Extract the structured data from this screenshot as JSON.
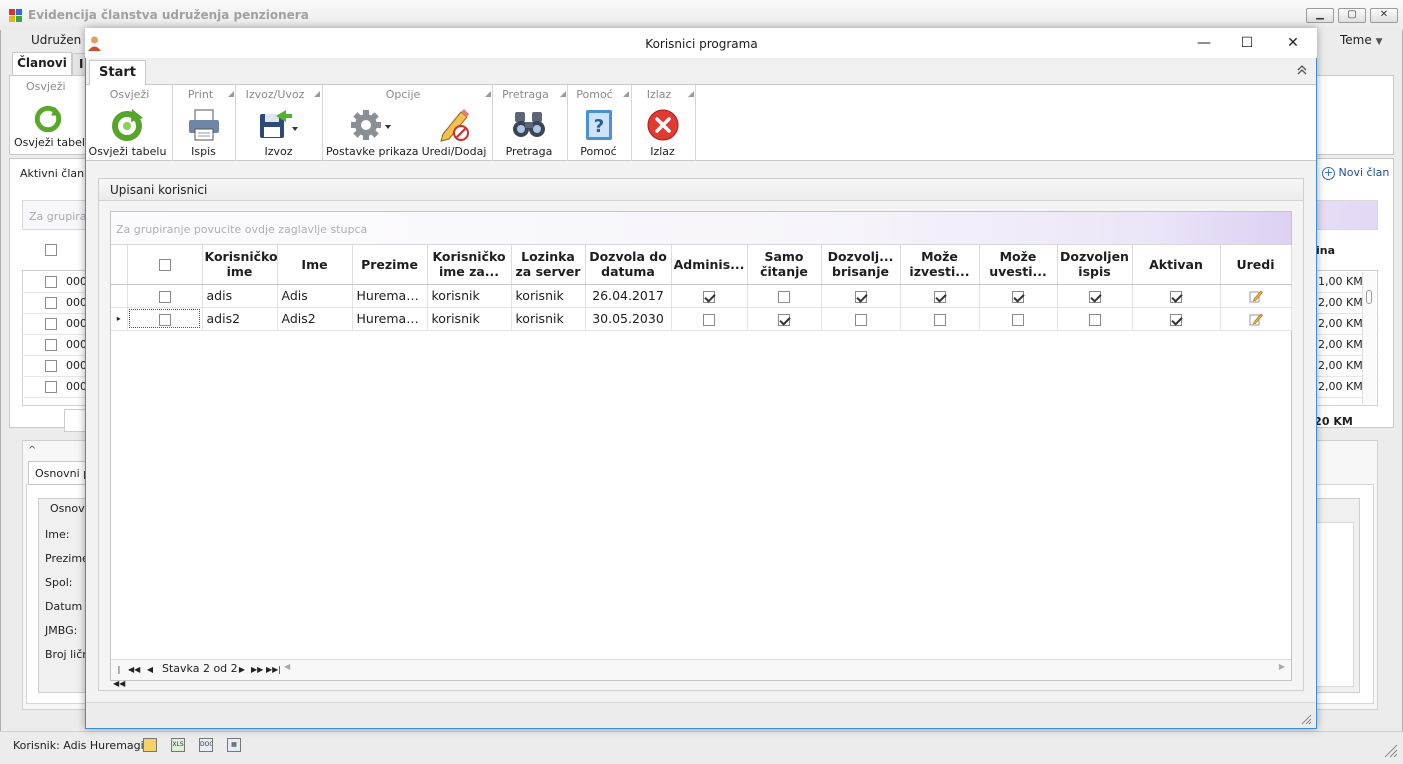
{
  "background": {
    "title": "Evidencija članstva udruženja penzionera",
    "menu_left": "Udružen",
    "menu_right": "Teme",
    "tab_clanovi": "Članovi",
    "tab_second": "I",
    "ribbon_group": "Osvježi",
    "refresh_label": "Osvježi tabelu",
    "aktivni": "Aktivni član",
    "novi_clan": "Novi član",
    "group_hint": "Za grupiranje",
    "col_ina": "ina",
    "rows": [
      {
        "code": "000",
        "km": "1,00 KM"
      },
      {
        "code": "000",
        "km": "2,00 KM"
      },
      {
        "code": "000",
        "km": "2,00 KM"
      },
      {
        "code": "000",
        "km": "2,00 KM"
      },
      {
        "code": "000",
        "km": "2,00 KM"
      },
      {
        "code": "000",
        "km": "2,00 KM"
      }
    ],
    "total": ",20 KM",
    "detail_tab": "Osnovni p",
    "detail_group": "Osnovn",
    "fields": [
      "Ime:",
      "Prezime:",
      "Spol:",
      "Datum ro",
      "JMBG:",
      "Broj lične"
    ],
    "status_user": "Korisnik: Adis Huremagic"
  },
  "dialog": {
    "title": "Korisnici programa",
    "tab_start": "Start",
    "ribbon": [
      {
        "group": "Osvježi",
        "label": "Osvježi tabelu",
        "icon": "refresh-icon"
      },
      {
        "group": "Print",
        "label": "Ispis",
        "icon": "printer-icon"
      },
      {
        "group": "Izvoz/Uvoz",
        "label": "Izvoz",
        "icon": "save-export-icon"
      },
      {
        "group": "Opcije",
        "label": "Postavke prikaza",
        "icon": "gear-icon"
      },
      {
        "group": "Opcije",
        "label": "Uredi/Dodaj",
        "icon": "edit-add-icon"
      },
      {
        "group": "Pretraga",
        "label": "Pretraga",
        "icon": "binoculars-icon"
      },
      {
        "group": "Pomoć",
        "label": "Pomoć",
        "icon": "help-icon"
      },
      {
        "group": "Izlaz",
        "label": "Izlaz",
        "icon": "exit-icon"
      }
    ],
    "panel_title": "Upisani korisnici",
    "group_hint": "Za grupiranje povucite ovdje zaglavlje stupca",
    "columns": [
      "Korisničko ime",
      "Ime",
      "Prezime",
      "Korisničko ime za...",
      "Lozinka za server",
      "Dozvola do datuma",
      "Adminis...",
      "Samo čitanje",
      "Dozvolj... brisanje",
      "Može izvesti...",
      "Može uvesti...",
      "Dozvoljen ispis",
      "Aktivan",
      "Uredi"
    ],
    "rows": [
      {
        "username": "adis",
        "ime": "Adis",
        "prezime": "Huremagic",
        "server_user": "korisnik",
        "server_pass": "korisnik",
        "dozvola": "26.04.2017",
        "flags": [
          true,
          false,
          true,
          true,
          true,
          true,
          true
        ]
      },
      {
        "username": "adis2",
        "ime": "Adis2",
        "prezime": "Huremagic",
        "server_user": "korisnik",
        "server_pass": "korisnik",
        "dozvola": "30.05.2030",
        "flags": [
          false,
          true,
          false,
          false,
          false,
          false,
          true
        ]
      }
    ],
    "navigator": "Stavka 2 od 2"
  }
}
